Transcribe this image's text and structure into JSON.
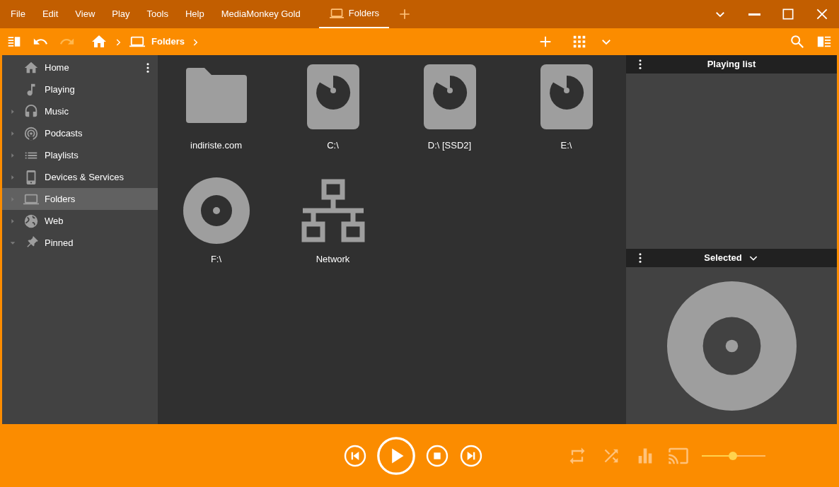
{
  "menu": [
    {
      "label": "File"
    },
    {
      "label": "Edit"
    },
    {
      "label": "View"
    },
    {
      "label": "Play"
    },
    {
      "label": "Tools"
    },
    {
      "label": "Help"
    },
    {
      "label": "MediaMonkey Gold"
    }
  ],
  "tabs": [
    {
      "label": "Folders",
      "selected": true
    }
  ],
  "toolbar": {
    "undo": {
      "disabled": false
    },
    "redo": {
      "disabled": true
    },
    "breadcrumb": [
      {
        "label": "Folders"
      }
    ]
  },
  "sidebar": {
    "items": [
      {
        "label": "Home",
        "has_children": false,
        "expanded": false,
        "selected": false
      },
      {
        "label": "Playing",
        "has_children": false,
        "expanded": false,
        "selected": false
      },
      {
        "label": "Music",
        "has_children": true,
        "expanded": false,
        "selected": false
      },
      {
        "label": "Podcasts",
        "has_children": true,
        "expanded": false,
        "selected": false
      },
      {
        "label": "Playlists",
        "has_children": true,
        "expanded": false,
        "selected": false
      },
      {
        "label": "Devices & Services",
        "has_children": true,
        "expanded": false,
        "selected": false
      },
      {
        "label": "Folders",
        "has_children": true,
        "expanded": false,
        "selected": true
      },
      {
        "label": "Web",
        "has_children": true,
        "expanded": false,
        "selected": false
      },
      {
        "label": "Pinned",
        "has_children": true,
        "expanded": true,
        "selected": false
      }
    ]
  },
  "folders": [
    {
      "label": "indiriste.com",
      "kind": "folder"
    },
    {
      "label": "C:\\",
      "kind": "drive"
    },
    {
      "label": "D:\\ [SSD2]",
      "kind": "drive"
    },
    {
      "label": "E:\\",
      "kind": "drive"
    },
    {
      "label": "F:\\",
      "kind": "disc"
    },
    {
      "label": "Network",
      "kind": "network"
    }
  ],
  "right_panel": {
    "playing_list": {
      "title": "Playing list"
    },
    "selected": {
      "title": "Selected"
    }
  },
  "player": {
    "volume": {
      "level": 0.49
    }
  }
}
